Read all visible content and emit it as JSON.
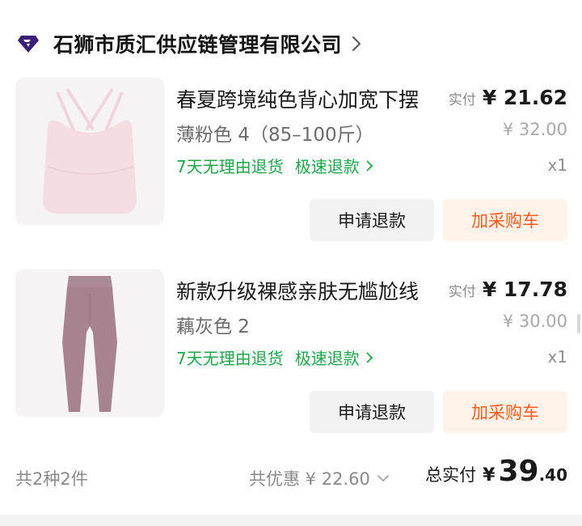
{
  "shop": {
    "name": "石狮市质汇供应链管理有限公司",
    "logo_icon": "diamond-gem-icon",
    "logo_color": "#3a1e78",
    "chevron_icon": "chevron-right-icon"
  },
  "products": [
    {
      "title": "春夏跨境纯色背心加宽下摆",
      "spec": "薄粉色 4（85–100斤）",
      "service": "7天无理由退货",
      "fast_refund": "极速退款",
      "paid_label": "实付",
      "paid_price": "¥ 21.62",
      "original_price": "¥ 32.00",
      "quantity": "x1",
      "refund_button": "申请退款",
      "cart_button": "加采购车",
      "image_icon": "sports-bra-image",
      "image_color": "#f3dde3"
    },
    {
      "title": "新款升级裸感亲肤无尴尬线",
      "spec": "藕灰色 2",
      "service": "7天无理由退货",
      "fast_refund": "极速退款",
      "paid_label": "实付",
      "paid_price": "¥ 17.78",
      "original_price": "¥ 30.00",
      "quantity": "x1",
      "refund_button": "申请退款",
      "cart_button": "加采购车",
      "image_icon": "leggings-image",
      "image_color": "#a5848f"
    }
  ],
  "summary": {
    "count_text": "共2种2件",
    "discount_text": "共优惠 ¥ 22.60",
    "total_label": "总实付",
    "total_currency": "¥",
    "total_int": "39",
    "total_dec": ".40"
  },
  "colors": {
    "service_green": "#1fa64a",
    "cart_orange": "#ff5a1e",
    "cart_bg": "#fff2e8",
    "refund_bg": "#f2f2f2"
  }
}
